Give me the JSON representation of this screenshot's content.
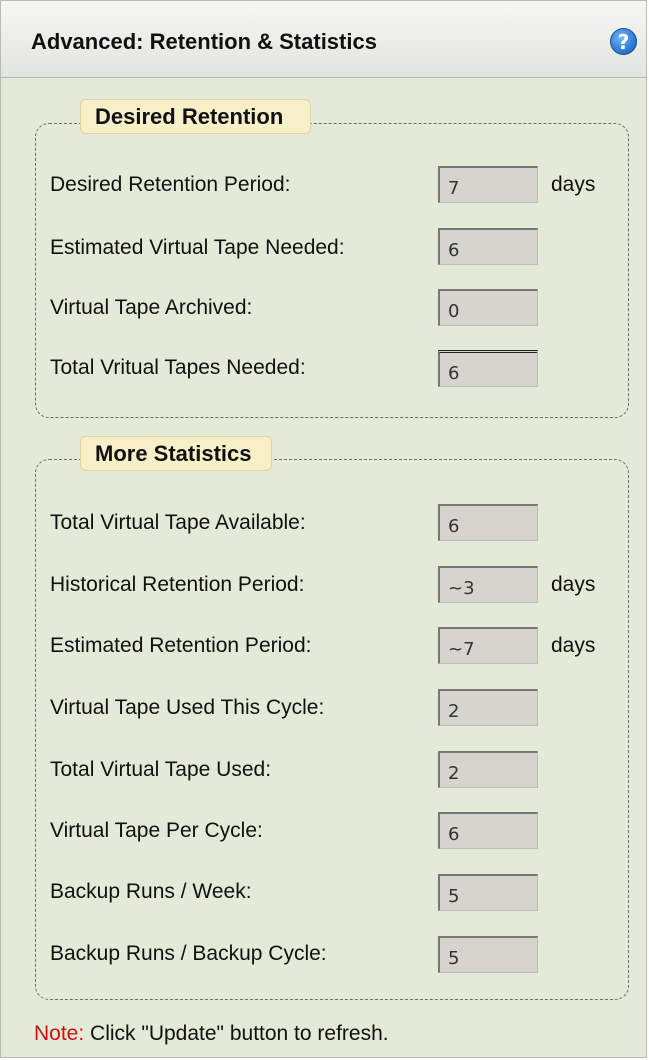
{
  "header": {
    "title": "Advanced: Retention & Statistics",
    "help_icon": "?"
  },
  "desired_retention": {
    "legend": "Desired Retention",
    "fields": [
      {
        "label": "Desired Retention Period:",
        "value": "7",
        "unit": "days"
      },
      {
        "label": "Estimated Virtual Tape Needed:",
        "value": "6"
      },
      {
        "label": "Virtual Tape Archived:",
        "value": "0"
      },
      {
        "label": "Total Vritual Tapes Needed:",
        "value": "6"
      }
    ]
  },
  "more_statistics": {
    "legend": "More Statistics",
    "fields": [
      {
        "label": "Total Virtual Tape Available:",
        "value": "6"
      },
      {
        "label": "Historical Retention Period:",
        "value": "~3",
        "unit": "days"
      },
      {
        "label": "Estimated Retention Period:",
        "value": "~7",
        "unit": "days"
      },
      {
        "label": "Virtual Tape Used This Cycle:",
        "value": "2"
      },
      {
        "label": "Total Virtual Tape Used:",
        "value": "2"
      },
      {
        "label": "Virtual Tape Per Cycle:",
        "value": "6"
      },
      {
        "label": "Backup Runs / Week:",
        "value": "5"
      },
      {
        "label": "Backup Runs / Backup Cycle:",
        "value": "5"
      }
    ]
  },
  "note": {
    "label": "Note:",
    "text": " Click \"Update\" button to refresh."
  }
}
